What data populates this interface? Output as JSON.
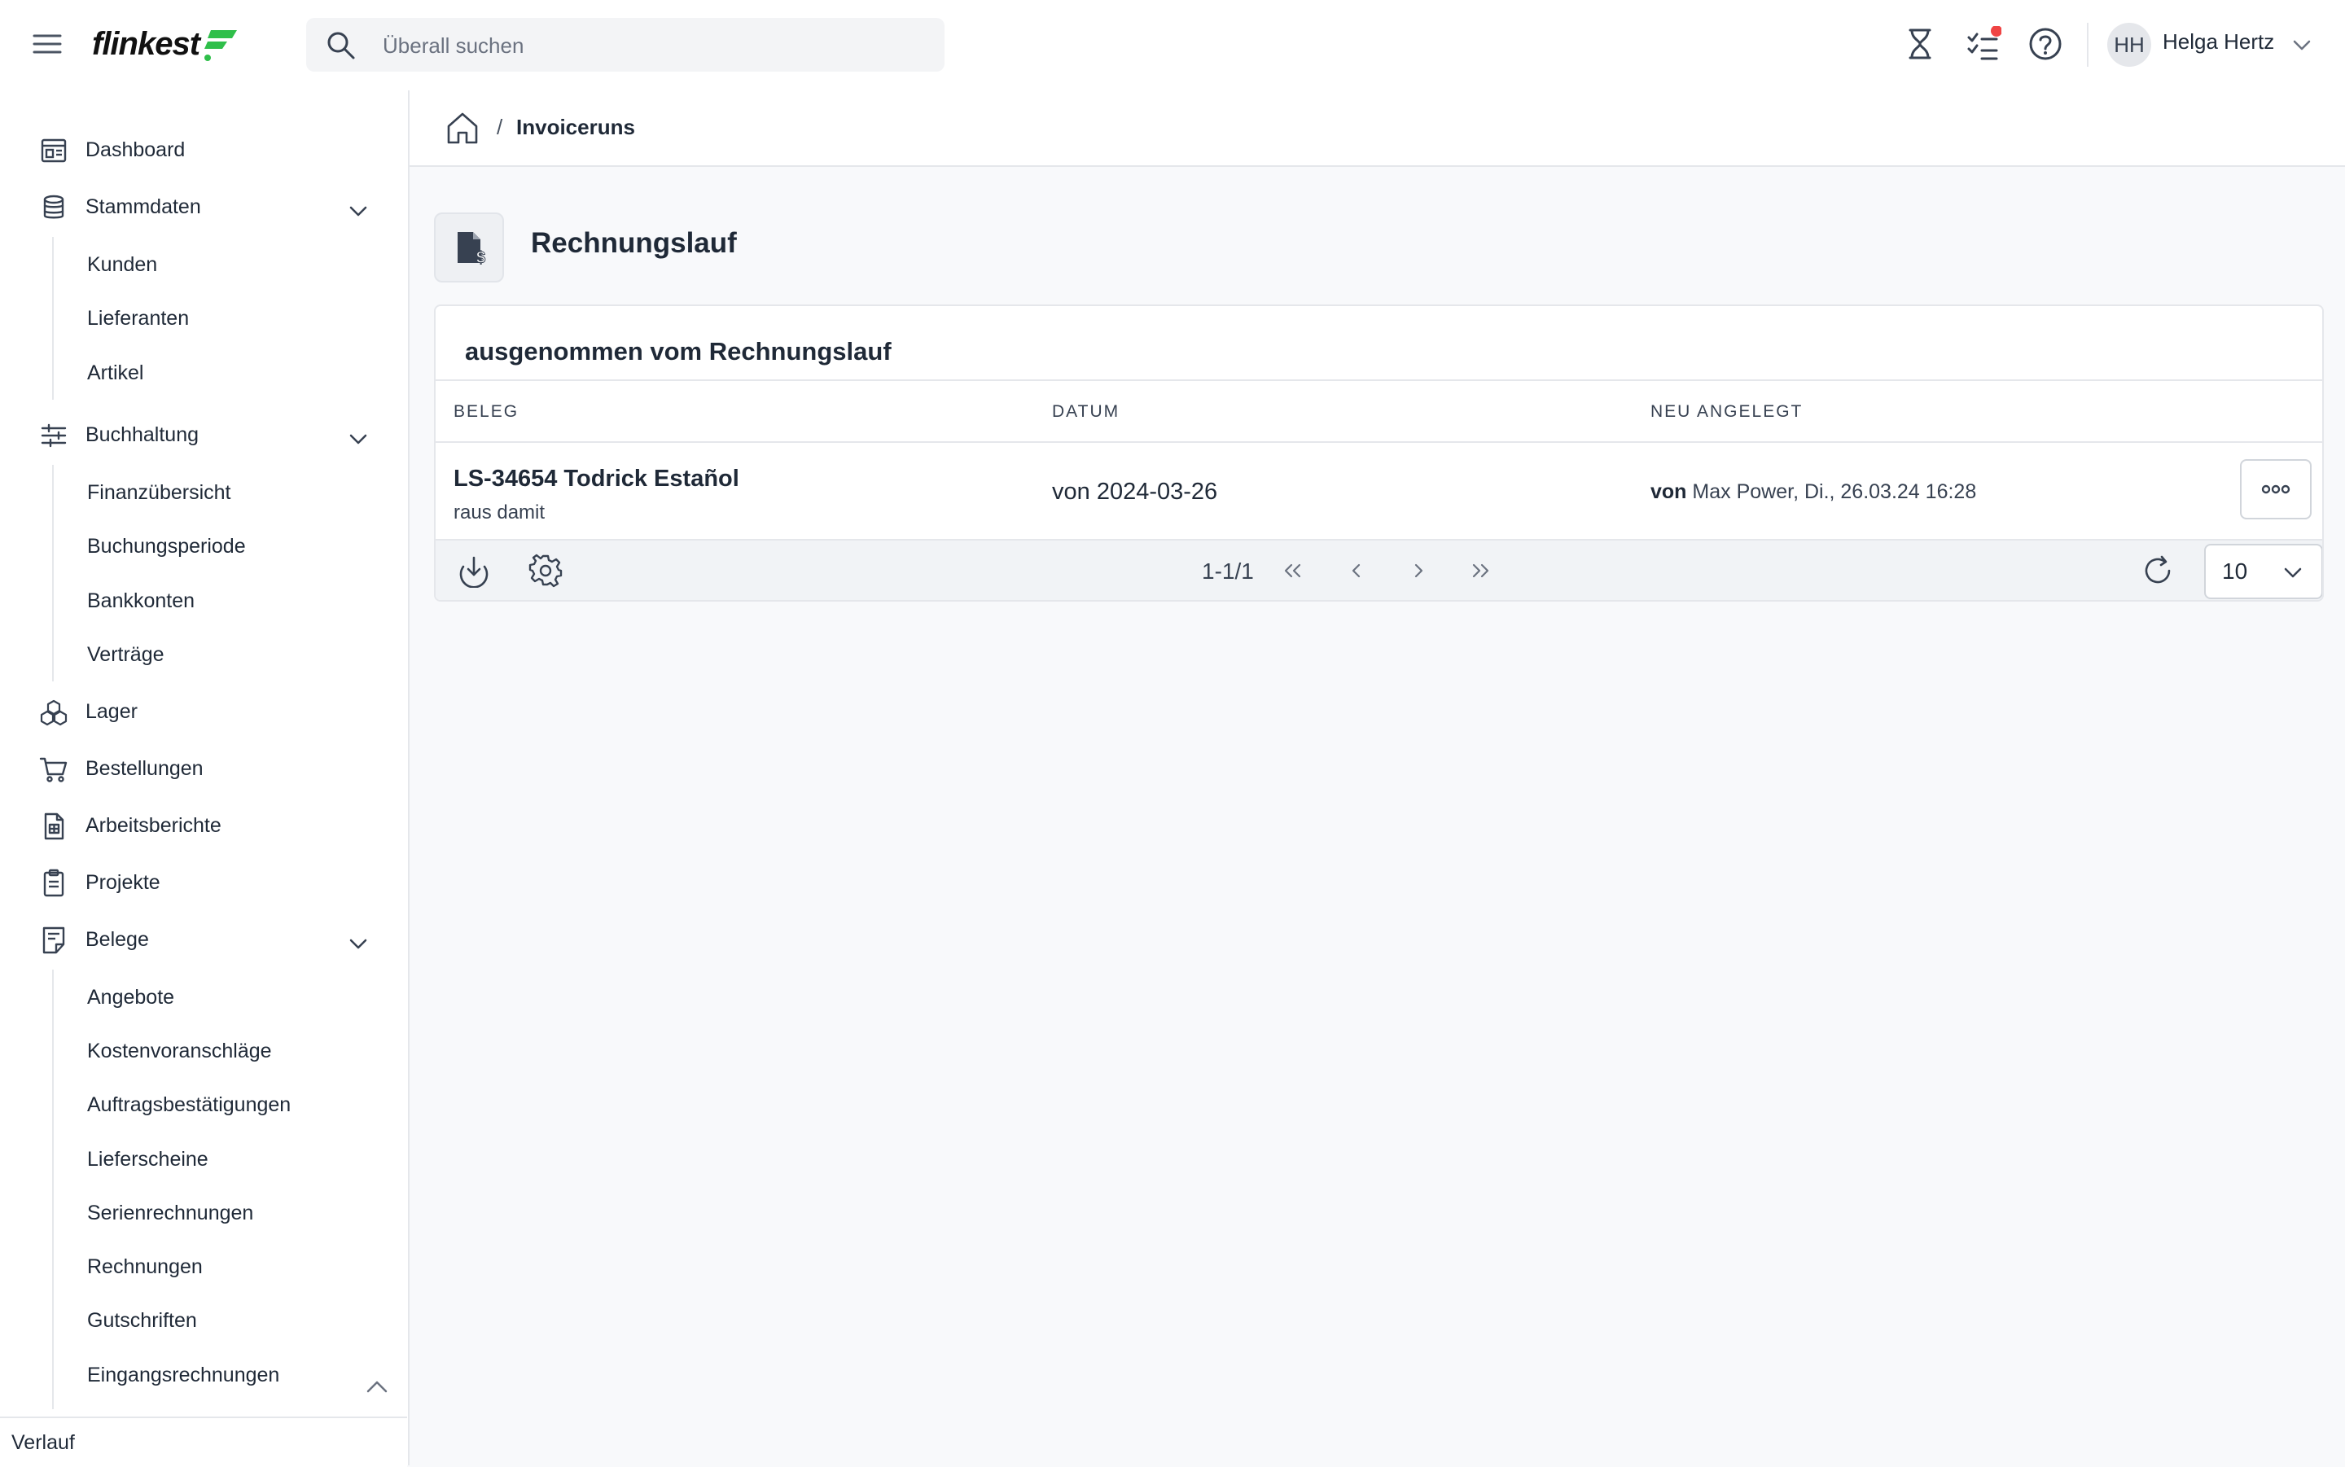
{
  "header": {
    "logo_text": "flinkest",
    "search_placeholder": "Überall suchen",
    "user_initials": "HH",
    "user_name": "Helga Hertz",
    "accent_color": "#2fbf4a",
    "notification_color": "#ef4444"
  },
  "sidebar": {
    "items": [
      {
        "label": "Dashboard",
        "icon": "dashboard-icon"
      },
      {
        "label": "Stammdaten",
        "icon": "database-icon",
        "children": [
          "Kunden",
          "Lieferanten",
          "Artikel"
        ]
      },
      {
        "label": "Buchhaltung",
        "icon": "sliders-icon",
        "children": [
          "Finanzübersicht",
          "Buchungsperiode",
          "Bankkonten",
          "Verträge"
        ]
      },
      {
        "label": "Lager",
        "icon": "boxes-icon"
      },
      {
        "label": "Bestellungen",
        "icon": "cart-icon"
      },
      {
        "label": "Arbeitsberichte",
        "icon": "report-icon"
      },
      {
        "label": "Projekte",
        "icon": "clipboard-icon"
      },
      {
        "label": "Belege",
        "icon": "document-icon",
        "children": [
          "Angebote",
          "Kostenvoranschläge",
          "Auftragsbestätigungen",
          "Lieferscheine",
          "Serienrechnungen",
          "Rechnungen",
          "Gutschriften",
          "Eingangsrechnungen"
        ]
      }
    ],
    "footer_label": "Verlauf"
  },
  "breadcrumb": {
    "separator": "/",
    "current": "Invoiceruns"
  },
  "page": {
    "title": "Rechnungslauf"
  },
  "card": {
    "title": "ausgenommen vom Rechnungslauf",
    "columns": [
      "BELEG",
      "DATUM",
      "NEU ANGELEGT"
    ],
    "rows": [
      {
        "beleg": "LS-34654 Todrick Estañol",
        "note": "raus damit",
        "datum": "von 2024-03-26",
        "created_prefix": "von",
        "created_text": "Max Power, Di., 26.03.24 16:28"
      }
    ],
    "pagination": "1-1/1",
    "per_page": "10"
  }
}
